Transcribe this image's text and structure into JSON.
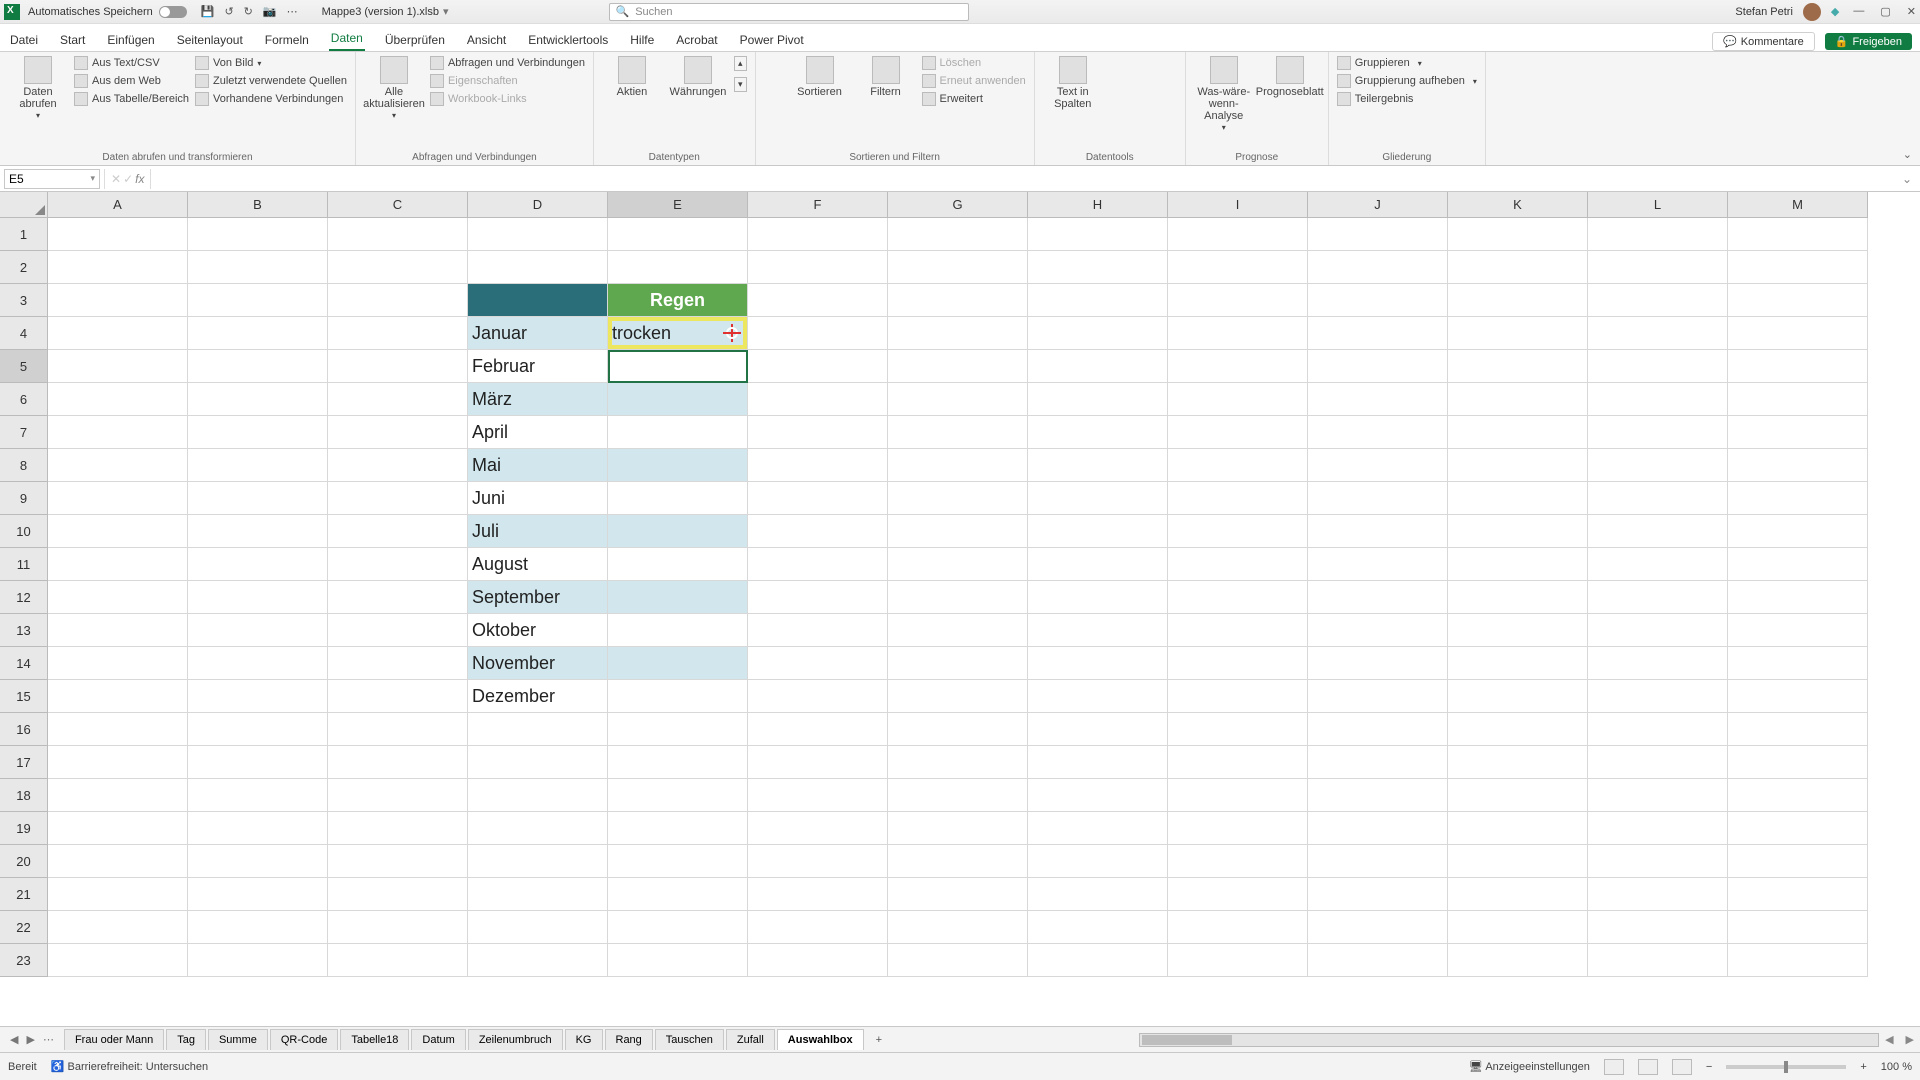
{
  "titlebar": {
    "autosave_label": "Automatisches Speichern",
    "doc_title": "Mappe3 (version 1).xlsb",
    "search_placeholder": "Suchen",
    "user_name": "Stefan Petri"
  },
  "tabs": {
    "items": [
      "Datei",
      "Start",
      "Einfügen",
      "Seitenlayout",
      "Formeln",
      "Daten",
      "Überprüfen",
      "Ansicht",
      "Entwicklertools",
      "Hilfe",
      "Acrobat",
      "Power Pivot"
    ],
    "active": "Daten",
    "comments": "Kommentare",
    "share": "Freigeben"
  },
  "ribbon": {
    "g1": {
      "label": "Daten abrufen und transformieren",
      "big": "Daten abrufen",
      "items": [
        "Aus Text/CSV",
        "Von Bild",
        "Aus dem Web",
        "Zuletzt verwendete Quellen",
        "Aus Tabelle/Bereich",
        "Vorhandene Verbindungen"
      ]
    },
    "g2": {
      "label": "Abfragen und Verbindungen",
      "big": "Alle aktualisieren",
      "items": [
        "Abfragen und Verbindungen",
        "Eigenschaften",
        "Workbook-Links"
      ]
    },
    "g3": {
      "label": "Datentypen",
      "a": "Aktien",
      "b": "Währungen"
    },
    "g4": {
      "label": "Sortieren und Filtern",
      "sort": "Sortieren",
      "filter": "Filtern",
      "items": [
        "Löschen",
        "Erneut anwenden",
        "Erweitert"
      ]
    },
    "g5": {
      "label": "Datentools",
      "big": "Text in Spalten"
    },
    "g6": {
      "label": "Prognose",
      "a": "Was-wäre-wenn-Analyse",
      "b": "Prognoseblatt"
    },
    "g7": {
      "label": "Gliederung",
      "items": [
        "Gruppieren",
        "Gruppierung aufheben",
        "Teilergebnis"
      ]
    }
  },
  "name_box": "E5",
  "formula": "",
  "columns": [
    "A",
    "B",
    "C",
    "D",
    "E",
    "F",
    "G",
    "H",
    "I",
    "J",
    "K",
    "L",
    "M"
  ],
  "rows": [
    "1",
    "2",
    "3",
    "4",
    "5",
    "6",
    "7",
    "8",
    "9",
    "10",
    "11",
    "12",
    "13",
    "14",
    "15",
    "16",
    "17",
    "18",
    "19",
    "20",
    "21",
    "22",
    "23"
  ],
  "table": {
    "header_blank": "",
    "header_regen": "Regen",
    "data": [
      {
        "month": "Januar",
        "val": "trocken"
      },
      {
        "month": "Februar",
        "val": ""
      },
      {
        "month": "März",
        "val": ""
      },
      {
        "month": "April",
        "val": ""
      },
      {
        "month": "Mai",
        "val": ""
      },
      {
        "month": "Juni",
        "val": ""
      },
      {
        "month": "Juli",
        "val": ""
      },
      {
        "month": "August",
        "val": ""
      },
      {
        "month": "September",
        "val": ""
      },
      {
        "month": "Oktober",
        "val": ""
      },
      {
        "month": "November",
        "val": ""
      },
      {
        "month": "Dezember",
        "val": ""
      }
    ]
  },
  "sheets": {
    "items": [
      "Frau oder Mann",
      "Tag",
      "Summe",
      "QR-Code",
      "Tabelle18",
      "Datum",
      "Zeilenumbruch",
      "KG",
      "Rang",
      "Tauschen",
      "Zufall",
      "Auswahlbox"
    ],
    "active": "Auswahlbox"
  },
  "status": {
    "ready": "Bereit",
    "acc": "Barrierefreiheit: Untersuchen",
    "display": "Anzeigeeinstellungen",
    "zoom": "100 %"
  }
}
